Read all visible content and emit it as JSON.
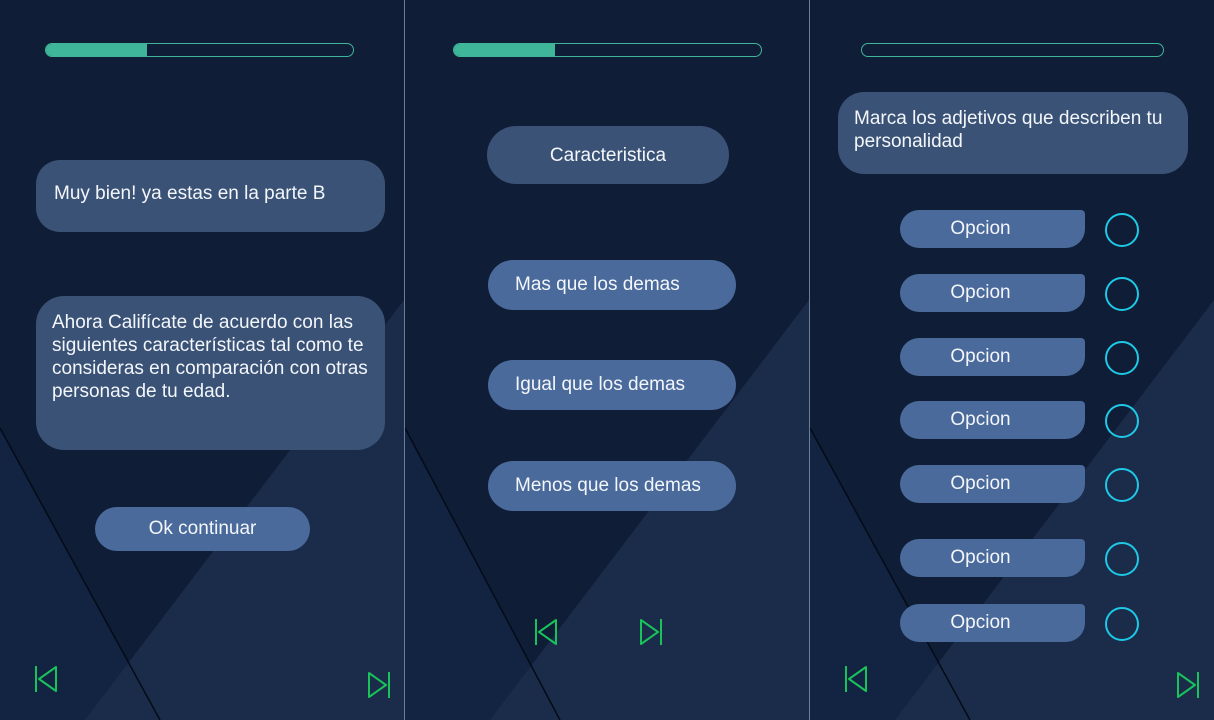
{
  "screen1": {
    "progress": 0.33,
    "message1": "Muy bien! ya estas en la parte B",
    "message2": "Ahora Califícate de acuerdo con las siguientes características tal como te consideras en comparación con otras personas de tu edad.",
    "continue_label": "Ok continuar",
    "nav_prev_icon": "skip-back-icon",
    "nav_next_icon": "skip-forward-icon"
  },
  "screen2": {
    "progress": 0.33,
    "characteristic_label": "Caracteristica",
    "options": [
      {
        "label": "Mas que los demas"
      },
      {
        "label": "Igual que los demas"
      },
      {
        "label": "Menos que los demas"
      }
    ],
    "nav_prev_icon": "skip-back-icon",
    "nav_next_icon": "skip-forward-icon"
  },
  "screen3": {
    "progress": 0,
    "question": "Marca los adjetivos que describen tu personalidad",
    "options": [
      {
        "label": "Opcion",
        "checked": false
      },
      {
        "label": "Opcion",
        "checked": false
      },
      {
        "label": "Opcion",
        "checked": false
      },
      {
        "label": "Opcion",
        "checked": false
      },
      {
        "label": "Opcion",
        "checked": false
      },
      {
        "label": "Opcion",
        "checked": false
      },
      {
        "label": "Opcion",
        "checked": false
      }
    ],
    "nav_prev_icon": "skip-back-icon",
    "nav_next_icon": "skip-forward-icon"
  },
  "colors": {
    "background": "#0f1d36",
    "accent_green": "#3fb59a",
    "nav_green": "#19c25a",
    "bubble": "#3a5276",
    "button": "#4a6a9b",
    "radio_cyan": "#1ec8e6"
  }
}
